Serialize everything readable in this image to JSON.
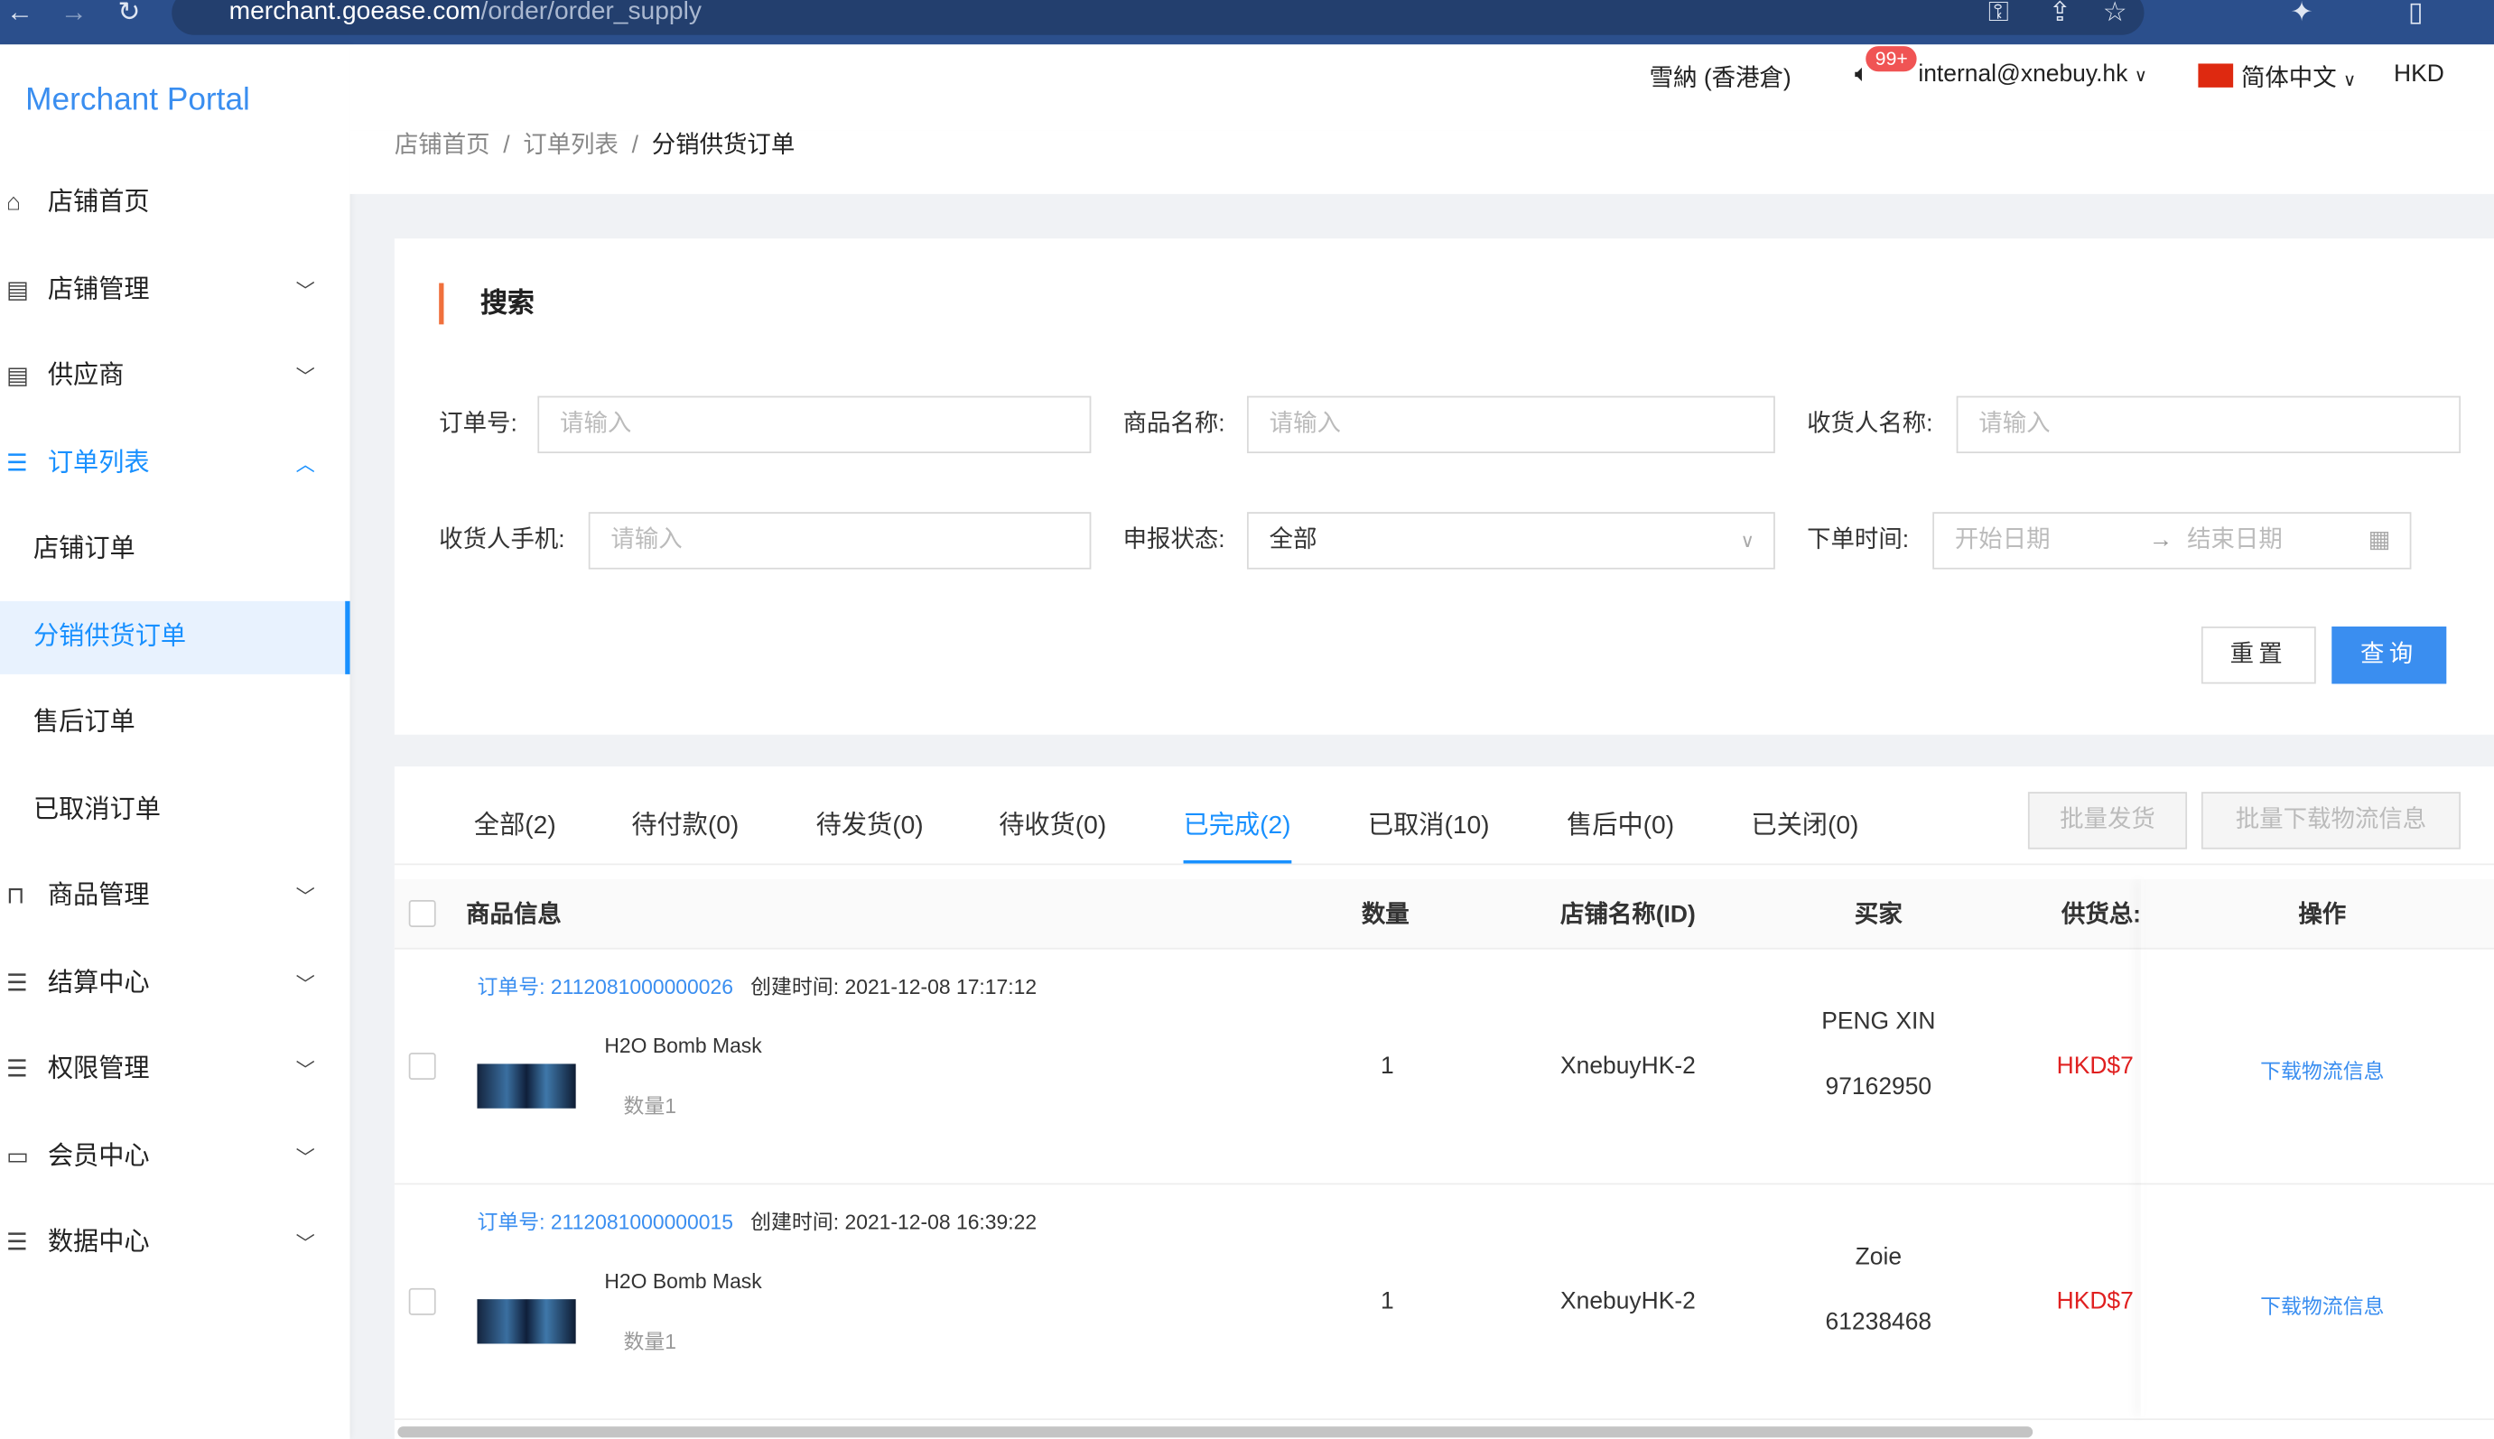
{
  "browser": {
    "url_host": "merchant.goease.com",
    "url_path": "/order/order_supply"
  },
  "app": {
    "title": "Merchant Portal"
  },
  "header": {
    "warehouse": "雪納 (香港倉)",
    "notification_count": "99+",
    "user_email": "internal@xnebuy.hk",
    "language": "简体中文",
    "currency": "HKD"
  },
  "sidebar": {
    "items": [
      {
        "label": "店铺首页",
        "icon": "home-icon"
      },
      {
        "label": "店铺管理",
        "icon": "store-icon"
      },
      {
        "label": "供应商",
        "icon": "store-icon"
      },
      {
        "label": "订单列表",
        "icon": "list-icon"
      },
      {
        "label": "店铺订单"
      },
      {
        "label": "分销供货订单"
      },
      {
        "label": "售后订单"
      },
      {
        "label": "已取消订单"
      },
      {
        "label": "商品管理",
        "icon": "bag-icon"
      },
      {
        "label": "结算中心",
        "icon": "list-icon"
      },
      {
        "label": "权限管理",
        "icon": "list-icon"
      },
      {
        "label": "会员中心",
        "icon": "id-card-icon"
      },
      {
        "label": "数据中心",
        "icon": "list-icon"
      }
    ]
  },
  "breadcrumb": [
    "店铺首页",
    "订单列表",
    "分销供货订单"
  ],
  "search": {
    "title": "搜索",
    "order_no_label": "订单号:",
    "product_name_label": "商品名称:",
    "receiver_name_label": "收货人名称:",
    "receiver_phone_label": "收货人手机:",
    "declare_status_label": "申报状态:",
    "order_time_label": "下单时间:",
    "placeholder": "请输入",
    "declare_status_value": "全部",
    "start_date": "开始日期",
    "end_date": "结束日期",
    "reset": "重置",
    "query": "查询"
  },
  "tabs": [
    "全部(2)",
    "待付款(0)",
    "待发货(0)",
    "待收货(0)",
    "已完成(2)",
    "已取消(10)",
    "售后中(0)",
    "已关闭(0)"
  ],
  "active_tab": "已完成(2)",
  "actions": {
    "batch_ship": "批量发货",
    "batch_download": "批量下载物流信息"
  },
  "table": {
    "columns": [
      "商品信息",
      "数量",
      "店铺名称(ID)",
      "买家",
      "供货总:",
      "操作"
    ],
    "rows": [
      {
        "order_no_label": "订单号:",
        "order_no": "2112081000000026",
        "created_label": "创建时间:",
        "created": "2021-12-08 17:17:12",
        "product": "H2O Bomb Mask",
        "qty_note": "数量1",
        "qty": "1",
        "store": "XnebuyHK-2",
        "buyer": "PENG XIN",
        "phone": "97162950",
        "total": "HKD$7",
        "action": "下载物流信息"
      },
      {
        "order_no_label": "订单号:",
        "order_no": "2112081000000015",
        "created_label": "创建时间:",
        "created": "2021-12-08 16:39:22",
        "product": "H2O Bomb Mask",
        "qty_note": "数量1",
        "qty": "1",
        "store": "XnebuyHK-2",
        "buyer": "Zoie",
        "phone": "61238468",
        "total": "HKD$7",
        "action": "下载物流信息"
      }
    ]
  },
  "colors": {
    "accent": "#1890ff",
    "price": "#e02020",
    "title_bar": "#f0703c"
  }
}
